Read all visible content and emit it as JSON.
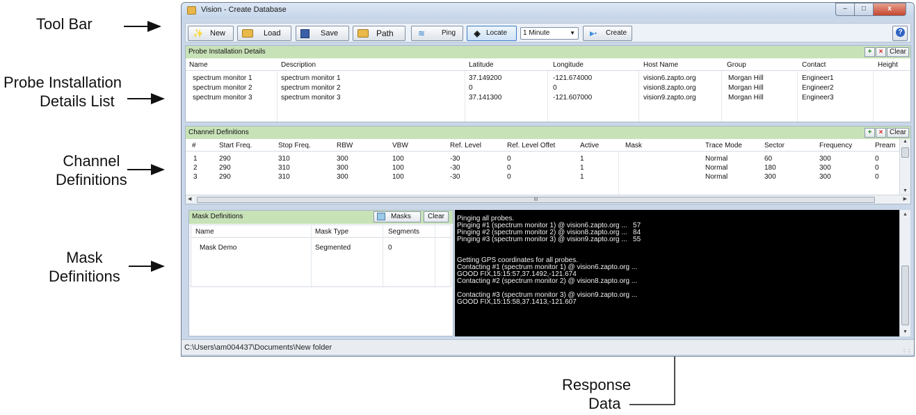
{
  "callouts": {
    "toolbar": "Tool Bar",
    "probe_line1": "Probe Installation",
    "probe_line2": "Details List",
    "channel_line1": "Channel",
    "channel_line2": "Definitions",
    "mask_line1": "Mask",
    "mask_line2": "Definitions",
    "response_line1": "Response",
    "response_line2": "Data"
  },
  "window": {
    "title": "Vision - Create Database",
    "minimize": "–",
    "maximize": "□",
    "close": "x"
  },
  "toolbar": {
    "new_label": "New",
    "load_label": "Load",
    "save_label": "Save",
    "path_label": "Path",
    "ping_label": "Ping",
    "locate_label": "Locate",
    "interval_value": "1 Minute",
    "create_label": "Create",
    "help_label": "?"
  },
  "probe_panel": {
    "title": "Probe Installation Details",
    "add": "+",
    "remove": "×",
    "clear": "Clear",
    "columns": [
      "Name",
      "Description",
      "Latitude",
      "Longitude",
      "Host Name",
      "Group",
      "Contact",
      "Height"
    ],
    "rows": [
      [
        "spectrum monitor 1",
        "spectrum monitor 1",
        "37.149200",
        "-121.674000",
        "vision6.zapto.org",
        "Morgan Hill",
        "Engineer1",
        ""
      ],
      [
        "spectrum monitor 2",
        "spectrum monitor 2",
        "0",
        "0",
        "vision8.zapto.org",
        "Morgan Hill",
        "Engineer2",
        ""
      ],
      [
        "spectrum monitor 3",
        "spectrum monitor 3",
        "37.141300",
        "-121.607000",
        "vision9.zapto.org",
        "Morgan Hill",
        "Engineer3",
        ""
      ]
    ]
  },
  "channel_panel": {
    "title": "Channel Definitions",
    "add": "+",
    "remove": "×",
    "clear": "Clear",
    "columns": [
      "#",
      "Start Freq.",
      "Stop Freq.",
      "RBW",
      "VBW",
      "Ref. Level",
      "Ref. Level Offet",
      "Active",
      "Mask",
      "Trace Mode",
      "Sector",
      "Frequency",
      "Pream"
    ],
    "rows": [
      [
        "1",
        "290",
        "310",
        "300",
        "100",
        "-30",
        "0",
        "1",
        "",
        "Normal",
        "60",
        "300",
        "0"
      ],
      [
        "2",
        "290",
        "310",
        "300",
        "100",
        "-30",
        "0",
        "1",
        "",
        "Normal",
        "180",
        "300",
        "0"
      ],
      [
        "3",
        "290",
        "310",
        "300",
        "100",
        "-30",
        "0",
        "1",
        "",
        "Normal",
        "300",
        "300",
        "0"
      ]
    ],
    "hscroll_grip": "III"
  },
  "mask_panel": {
    "title": "Mask Definitions",
    "masks_label": "Masks",
    "clear": "Clear",
    "columns": [
      "Name",
      "Mask Type",
      "Segments"
    ],
    "rows": [
      [
        "Mask Demo",
        "Segmented",
        "0"
      ]
    ]
  },
  "response_lines": [
    "Pinging all probes.",
    "Pinging #1 (spectrum monitor 1) @ vision6.zapto.org ...   57",
    "Pinging #2 (spectrum monitor 2) @ vision8.zapto.org ...   84",
    "Pinging #3 (spectrum monitor 3) @ vision9.zapto.org ...   55",
    "",
    "",
    "Getting GPS coordinates for all probes.",
    "Contacting #1 (spectrum monitor 1) @ vision6.zapto.org ...",
    "GOOD FIX,15:15:57,37.1492,-121.674",
    "Contacting #2 (spectrum monitor 2) @ vision8.zapto.org ...",
    "",
    "Contacting #3 (spectrum monitor 3) @ vision9.zapto.org ...",
    "GOOD FIX,15:15:58,37.1413,-121.607"
  ],
  "status_path": "C:\\Users\\am004437\\Documents\\New folder",
  "colors": {
    "panel_header": "#c8e2b8",
    "console_bg": "#000000",
    "window_frame": "#c9d7e8"
  }
}
